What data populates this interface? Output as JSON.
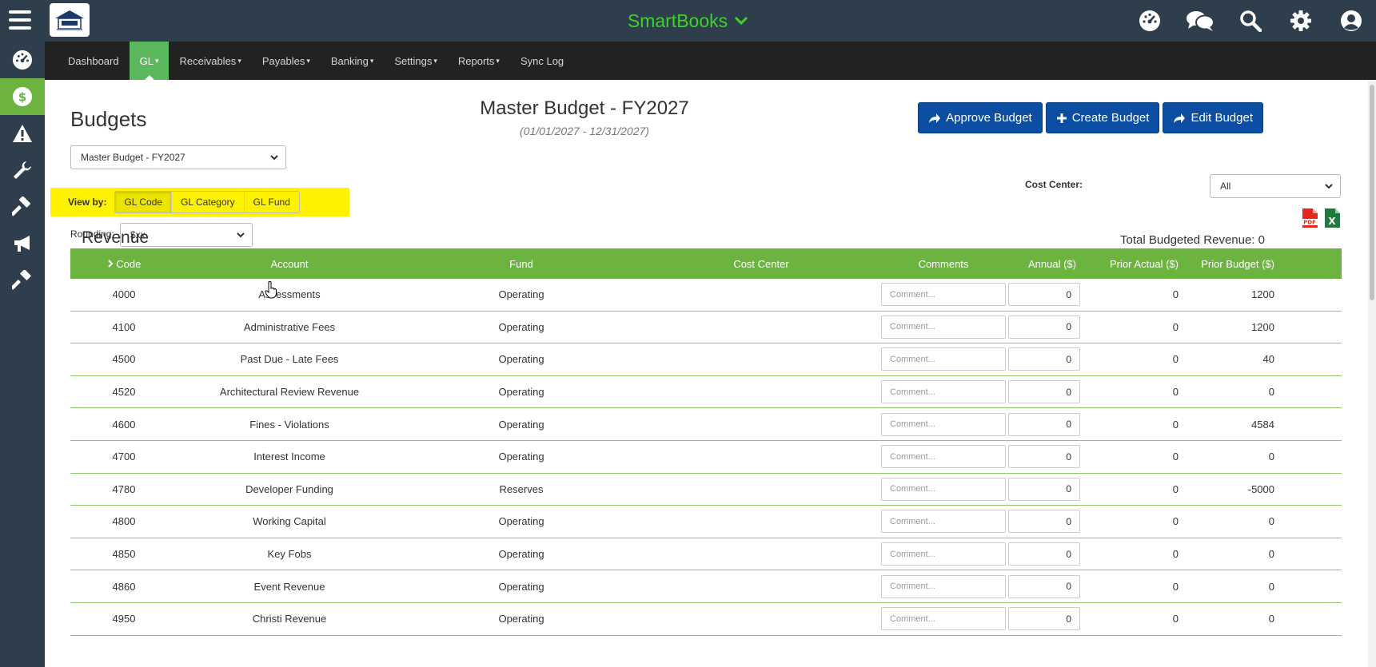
{
  "topbar": {
    "app_title": "SmartBooks",
    "icons": [
      "dashboard-icon",
      "chat-icon",
      "search-icon",
      "gear-icon",
      "user-icon"
    ]
  },
  "sidebar": {
    "items": [
      "dashboard-icon",
      "dollar-icon",
      "warning-icon",
      "wrench-icon",
      "hammer-icon",
      "megaphone-icon",
      "gavel-icon"
    ],
    "active": "dollar-icon"
  },
  "nav": {
    "items": [
      {
        "label": "Dashboard",
        "caret": ""
      },
      {
        "label": "GL",
        "caret": "▾"
      },
      {
        "label": "Receivables",
        "caret": "▾"
      },
      {
        "label": "Payables",
        "caret": "▾"
      },
      {
        "label": "Banking",
        "caret": "▾"
      },
      {
        "label": "Settings",
        "caret": "▾"
      },
      {
        "label": "Reports",
        "caret": "▾"
      },
      {
        "label": "Sync Log",
        "caret": ""
      }
    ],
    "active": "GL"
  },
  "page": {
    "title": "Budgets",
    "budget_name": "Master Budget - FY2027",
    "budget_range": "(01/01/2027 - 12/31/2027)"
  },
  "buttons": {
    "approve": "Approve Budget",
    "create": "Create Budget",
    "edit": "Edit Budget"
  },
  "budget_select": {
    "value": "Master Budget - FY2027"
  },
  "view_by": {
    "label": "View by:",
    "options": [
      "GL Code",
      "GL Category",
      "GL Fund"
    ],
    "active": "GL Code"
  },
  "rounding": {
    "label": "Rounding:",
    "value": "$xx"
  },
  "cost_center": {
    "label": "Cost Center:",
    "value": "All"
  },
  "section": {
    "title": "Revenue",
    "total": "Total Budgeted Revenue: 0"
  },
  "table": {
    "headers": {
      "code": "Code",
      "account": "Account",
      "fund": "Fund",
      "cost_center": "Cost Center",
      "comments": "Comments",
      "annual": "Annual ($)",
      "prior_actual": "Prior Actual ($)",
      "prior_budget": "Prior Budget ($)"
    },
    "comment_placeholder": "Comment...",
    "rows": [
      {
        "code": "4000",
        "account": "Assessments",
        "fund": "Operating",
        "cost_center": "",
        "annual": "0",
        "prior_actual": "0",
        "prior_budget": "1200"
      },
      {
        "code": "4100",
        "account": "Administrative Fees",
        "fund": "Operating",
        "cost_center": "",
        "annual": "0",
        "prior_actual": "0",
        "prior_budget": "1200"
      },
      {
        "code": "4500",
        "account": "Past Due - Late Fees",
        "fund": "Operating",
        "cost_center": "",
        "annual": "0",
        "prior_actual": "0",
        "prior_budget": "40"
      },
      {
        "code": "4520",
        "account": "Architectural Review Revenue",
        "fund": "Operating",
        "cost_center": "",
        "annual": "0",
        "prior_actual": "0",
        "prior_budget": "0"
      },
      {
        "code": "4600",
        "account": "Fines - Violations",
        "fund": "Operating",
        "cost_center": "",
        "annual": "0",
        "prior_actual": "0",
        "prior_budget": "4584"
      },
      {
        "code": "4700",
        "account": "Interest Income",
        "fund": "Operating",
        "cost_center": "",
        "annual": "0",
        "prior_actual": "0",
        "prior_budget": "0"
      },
      {
        "code": "4780",
        "account": "Developer Funding",
        "fund": "Reserves",
        "cost_center": "",
        "annual": "0",
        "prior_actual": "0",
        "prior_budget": "-5000"
      },
      {
        "code": "4800",
        "account": "Working Capital",
        "fund": "Operating",
        "cost_center": "",
        "annual": "0",
        "prior_actual": "0",
        "prior_budget": "0"
      },
      {
        "code": "4850",
        "account": "Key Fobs",
        "fund": "Operating",
        "cost_center": "",
        "annual": "0",
        "prior_actual": "0",
        "prior_budget": "0"
      },
      {
        "code": "4860",
        "account": "Event Revenue",
        "fund": "Operating",
        "cost_center": "",
        "annual": "0",
        "prior_actual": "0",
        "prior_budget": "0"
      },
      {
        "code": "4950",
        "account": "Christi Revenue",
        "fund": "Operating",
        "cost_center": "",
        "annual": "0",
        "prior_actual": "0",
        "prior_budget": "0"
      }
    ]
  },
  "colors": {
    "topbar": "#2f3e4c",
    "navbar": "#222222",
    "accent_green": "#6cb33f",
    "brand_text": "#3fd12b",
    "button_blue": "#0b4ea2",
    "highlight": "#fff200"
  }
}
